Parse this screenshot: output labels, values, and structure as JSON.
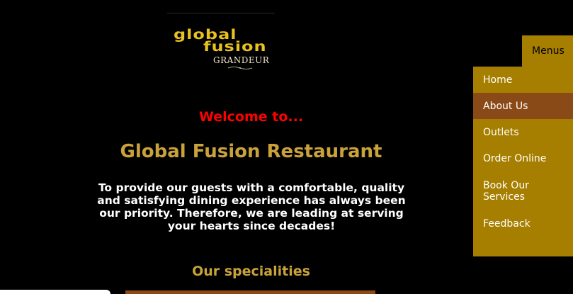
{
  "logo": {
    "line1": "global",
    "line2": "fusion",
    "subtitle": "GRANDEUR"
  },
  "hero": {
    "welcome": "Welcome to...",
    "restaurant_name": "Global Fusion Restaurant",
    "mission": "To provide our guests with a comfortable, quality and satisfying dining experience has always been our priority. Therefore, we are leading at serving your hearts since decades!",
    "specialities_heading": "Our specialities"
  },
  "menu": {
    "toggle_label": "Menus",
    "items": [
      {
        "label": "Home",
        "active": false
      },
      {
        "label": "About Us",
        "active": true
      },
      {
        "label": "Outlets",
        "active": false
      },
      {
        "label": "Order Online",
        "active": false
      },
      {
        "label": "Book Our Services",
        "active": false
      },
      {
        "label": "Feedback",
        "active": false
      }
    ]
  },
  "colors": {
    "background": "#000000",
    "accent_gold": "#c9a23a",
    "menu_gold": "#a77f00",
    "menu_active": "#8a4a18",
    "welcome_red": "#ff0000"
  }
}
